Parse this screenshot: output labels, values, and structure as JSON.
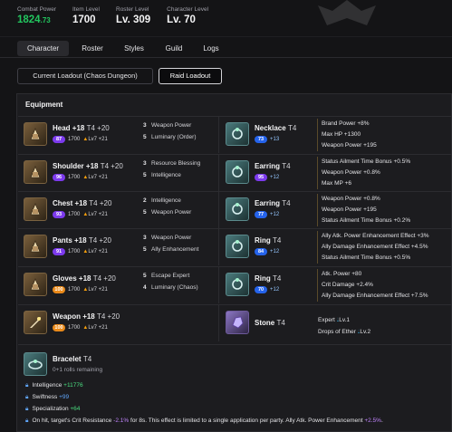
{
  "header": {
    "combat_power_label": "Combat Power",
    "combat_power_int": "1824",
    "combat_power_dec": ".73",
    "item_level_label": "Item Level",
    "item_level": "1700",
    "roster_level_label": "Roster Level",
    "roster_level": "Lv. 309",
    "character_level_label": "Character Level",
    "character_level": "Lv. 70"
  },
  "tabs": [
    "Character",
    "Roster",
    "Styles",
    "Guild",
    "Logs"
  ],
  "loadouts": [
    "Current Loadout (Chaos Dungeon)",
    "Raid Loadout"
  ],
  "equipment": {
    "title": "Equipment",
    "gear": [
      {
        "name": "Head +18",
        "tier": "T4 +20",
        "quality": "87",
        "ilvl": "1700",
        "honing": "Lv7 +21",
        "engravings": [
          {
            "n": "3",
            "name": "Weapon Power"
          },
          {
            "n": "5",
            "name": "Luminary (Order)"
          }
        ]
      },
      {
        "name": "Shoulder +18",
        "tier": "T4 +20",
        "quality": "96",
        "ilvl": "1700",
        "honing": "Lv7 +21",
        "engravings": [
          {
            "n": "3",
            "name": "Resource Blessing"
          },
          {
            "n": "5",
            "name": "Intelligence"
          }
        ]
      },
      {
        "name": "Chest +18",
        "tier": "T4 +20",
        "quality": "93",
        "ilvl": "1700",
        "honing": "Lv7 +21",
        "engravings": [
          {
            "n": "2",
            "name": "Intelligence"
          },
          {
            "n": "5",
            "name": "Weapon Power"
          }
        ]
      },
      {
        "name": "Pants +18",
        "tier": "T4 +20",
        "quality": "91",
        "ilvl": "1700",
        "honing": "Lv7 +21",
        "engravings": [
          {
            "n": "3",
            "name": "Weapon Power"
          },
          {
            "n": "5",
            "name": "Ally Enhancement"
          }
        ]
      },
      {
        "name": "Gloves +18",
        "tier": "T4 +20",
        "quality": "100",
        "ilvl": "1700",
        "honing": "Lv7 +21",
        "engravings": [
          {
            "n": "5",
            "name": "Escape Expert"
          },
          {
            "n": "4",
            "name": "Luminary (Chaos)"
          }
        ]
      },
      {
        "name": "Weapon +18",
        "tier": "T4 +20",
        "quality": "100",
        "ilvl": "1700",
        "honing": "Lv7 +21",
        "engravings": []
      }
    ],
    "accessories": [
      {
        "name": "Necklace",
        "tier": "T4",
        "quality": "73",
        "plus": "+13",
        "effects": [
          "Brand Power +8%",
          "Max HP +1300",
          "Weapon Power +195"
        ]
      },
      {
        "name": "Earring",
        "tier": "T4",
        "quality": "95",
        "plus": "+12",
        "effects": [
          "Status Ailment Time Bonus +0.5%",
          "Weapon Power +0.8%",
          "Max MP +6"
        ]
      },
      {
        "name": "Earring",
        "tier": "T4",
        "quality": "77",
        "plus": "+12",
        "effects": [
          "Weapon Power +0.8%",
          "Weapon Power +195",
          "Status Ailment Time Bonus +0.2%"
        ]
      },
      {
        "name": "Ring",
        "tier": "T4",
        "quality": "84",
        "plus": "+12",
        "effects": [
          "Ally Atk. Power Enhancement Effect +3%",
          "Ally Damage Enhancement Effect +4.5%",
          "Status Ailment Time Bonus +0.5%"
        ]
      },
      {
        "name": "Ring",
        "tier": "T4",
        "quality": "70",
        "plus": "+12",
        "effects": [
          "Atk. Power +80",
          "Crit Damage +2.4%",
          "Ally Damage Enhancement Effect +7.5%"
        ]
      }
    ],
    "stone": {
      "name": "Stone",
      "tier": "T4",
      "effects": [
        {
          "name": "Expert",
          "level": "Lv.1"
        },
        {
          "name": "Drops of Ether",
          "level": "Lv.2"
        }
      ]
    },
    "bracelet": {
      "name": "Bracelet",
      "tier": "T4",
      "rolls": "0+1 rolls remaining",
      "stats": [
        {
          "name": "Intelligence",
          "value": "+11776"
        },
        {
          "name": "Swiftness",
          "value": "+99"
        },
        {
          "name": "Specialization",
          "value": "+64"
        }
      ],
      "effect_pre": "On hit, target's Crit Resistance ",
      "effect_val1": "-2.1%",
      "effect_mid": " for 8s. This effect is limited to a single application per party. Ally Atk. Power Enhancement ",
      "effect_val2": "+2.5%",
      "effect_end": "."
    }
  },
  "colors": {
    "accent_green": "#22c55e",
    "bg": "#141416",
    "panel": "#1c1c1f"
  }
}
